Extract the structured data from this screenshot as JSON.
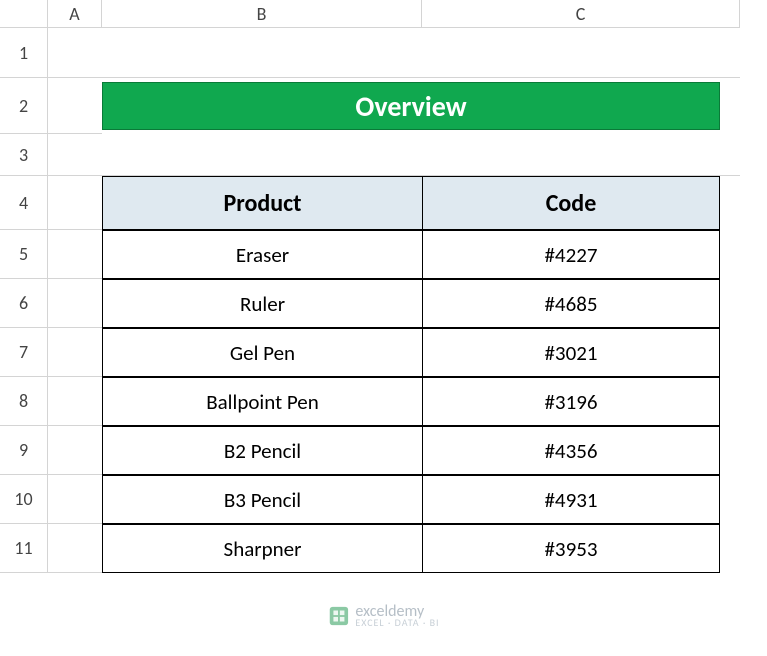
{
  "columns": [
    "A",
    "B",
    "C"
  ],
  "rows": [
    "1",
    "2",
    "3",
    "4",
    "5",
    "6",
    "7",
    "8",
    "9",
    "10",
    "11"
  ],
  "banner": {
    "title": "Overview"
  },
  "table": {
    "headers": {
      "product": "Product",
      "code": "Code"
    },
    "data": [
      {
        "product": "Eraser",
        "code": "#4227"
      },
      {
        "product": "Ruler",
        "code": "#4685"
      },
      {
        "product": "Gel Pen",
        "code": "#3021"
      },
      {
        "product": "Ballpoint Pen",
        "code": "#3196"
      },
      {
        "product": "B2 Pencil",
        "code": "#4356"
      },
      {
        "product": "B3 Pencil",
        "code": "#4931"
      },
      {
        "product": "Sharpner",
        "code": "#3953"
      }
    ]
  },
  "watermark": {
    "brand": "exceldemy",
    "tagline": "EXCEL · DATA · BI"
  },
  "chart_data": {
    "type": "table",
    "title": "Overview",
    "columns": [
      "Product",
      "Code"
    ],
    "rows": [
      [
        "Eraser",
        "#4227"
      ],
      [
        "Ruler",
        "#4685"
      ],
      [
        "Gel Pen",
        "#3021"
      ],
      [
        "Ballpoint Pen",
        "#3196"
      ],
      [
        "B2 Pencil",
        "#4356"
      ],
      [
        "B3 Pencil",
        "#4931"
      ],
      [
        "Sharpner",
        "#3953"
      ]
    ]
  }
}
